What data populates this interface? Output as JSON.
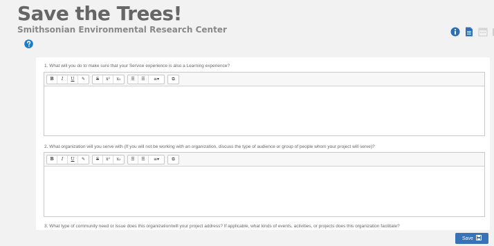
{
  "header": {
    "title": "Save the Trees!",
    "subtitle": "Smithsonian Environmental Research Center",
    "icons": [
      "info-icon",
      "document-icon",
      "calendar-icon"
    ]
  },
  "help": {
    "icon": "question-icon"
  },
  "questions": [
    {
      "text": "1. What will you do to make sure that your Service experience is also a Learning experience?"
    },
    {
      "text": "2. What organization will you serve with (If you will not be working with an organization, discuss the type of audience or group of people whom your project will serve)?"
    },
    {
      "text": "3. What type of community need or issue does this organization/will your project address? If applicable, what kinds of events, activities, or projects does this organization facilitate?"
    }
  ],
  "toolbar": {
    "bold": "B",
    "italic": "I",
    "underline": "U",
    "eraser": "✎",
    "strike": "S",
    "superscript": "x²",
    "subscript": "x₂",
    "list_ul": "☰",
    "list_ol": "☰",
    "align": "≡▾",
    "link": "⧉"
  },
  "footer": {
    "save_label": "Save"
  },
  "colors": {
    "accent": "#3a72b8",
    "info": "#2f6db5",
    "help": "#1f7ac4"
  }
}
